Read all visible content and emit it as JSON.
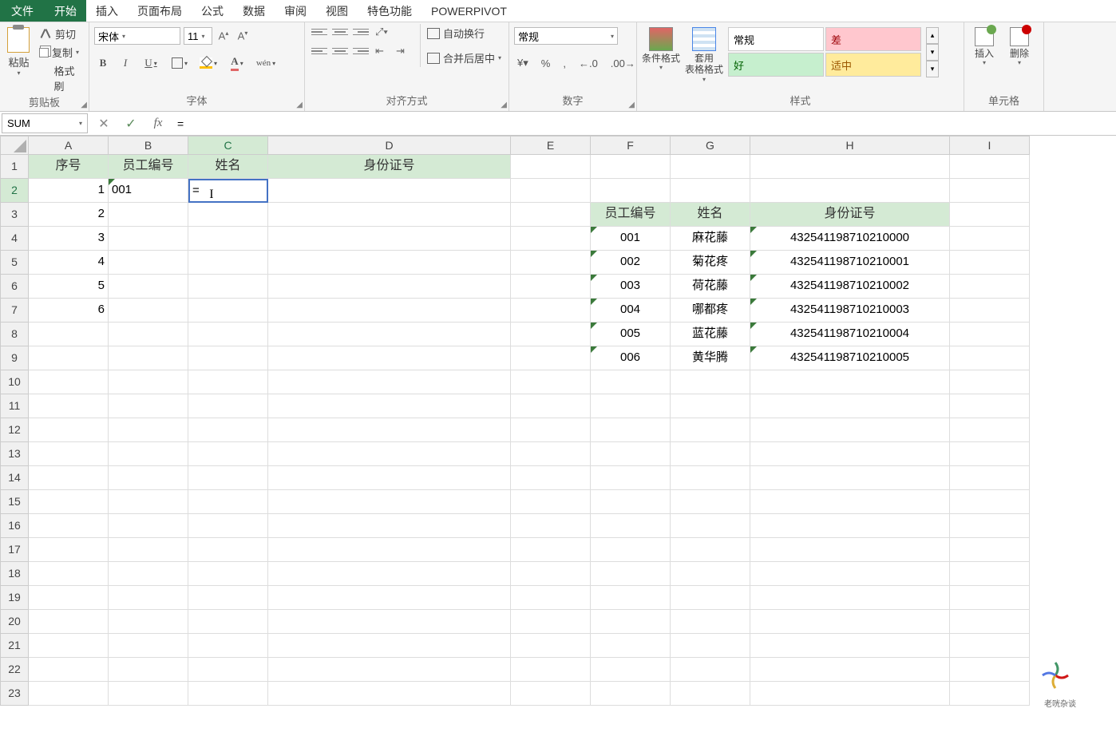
{
  "menu": {
    "file": "文件",
    "tabs": [
      "开始",
      "插入",
      "页面布局",
      "公式",
      "数据",
      "审阅",
      "视图",
      "特色功能",
      "POWERPIVOT"
    ],
    "active_index": 0
  },
  "ribbon": {
    "clipboard": {
      "label": "剪贴板",
      "paste": "粘贴",
      "cut": "剪切",
      "copy": "复制",
      "brush": "格式刷"
    },
    "font": {
      "label": "字体",
      "name": "宋体",
      "size": "11",
      "bold": "B",
      "italic": "I",
      "underline": "U",
      "wen": "wén"
    },
    "align": {
      "label": "对齐方式",
      "wrap": "自动换行",
      "merge": "合并后居中"
    },
    "number": {
      "label": "数字",
      "format": "常规",
      "percent": "%",
      "comma": ",",
      "dec_inc": ".0",
      "dec_dec": ".00"
    },
    "styles": {
      "label": "样式",
      "cond": "条件格式",
      "table": "套用\n表格格式",
      "normal": "常规",
      "bad": "差",
      "good": "好",
      "neutral": "适中"
    },
    "cells": {
      "label": "单元格",
      "insert": "插入",
      "delete": "删除"
    }
  },
  "formula_bar": {
    "name_box": "SUM",
    "fx": "fx",
    "value": "="
  },
  "columns": [
    "A",
    "B",
    "C",
    "D",
    "E",
    "F",
    "G",
    "H",
    "I"
  ],
  "row_count": 23,
  "selection": {
    "row": 2,
    "col": "C"
  },
  "sheet": {
    "headers_left": {
      "A": "序号",
      "B": "员工编号",
      "C": "姓名",
      "D": "身份证号"
    },
    "left_rows": [
      {
        "A": "1",
        "B": "001",
        "C": "="
      },
      {
        "A": "2"
      },
      {
        "A": "3"
      },
      {
        "A": "4"
      },
      {
        "A": "5"
      },
      {
        "A": "6"
      }
    ],
    "right_header_row": 3,
    "headers_right": {
      "F": "员工编号",
      "G": "姓名",
      "H": "身份证号"
    },
    "right_rows": [
      {
        "F": "001",
        "G": "麻花藤",
        "H": "432541198710210000"
      },
      {
        "F": "002",
        "G": "菊花疼",
        "H": "432541198710210001"
      },
      {
        "F": "003",
        "G": "荷花藤",
        "H": "432541198710210002"
      },
      {
        "F": "004",
        "G": "哪都疼",
        "H": "432541198710210003"
      },
      {
        "F": "005",
        "G": "蓝花藤",
        "H": "432541198710210004"
      },
      {
        "F": "006",
        "G": "黄华腾",
        "H": "432541198710210005"
      }
    ]
  },
  "watermark": "老咣杂谈"
}
